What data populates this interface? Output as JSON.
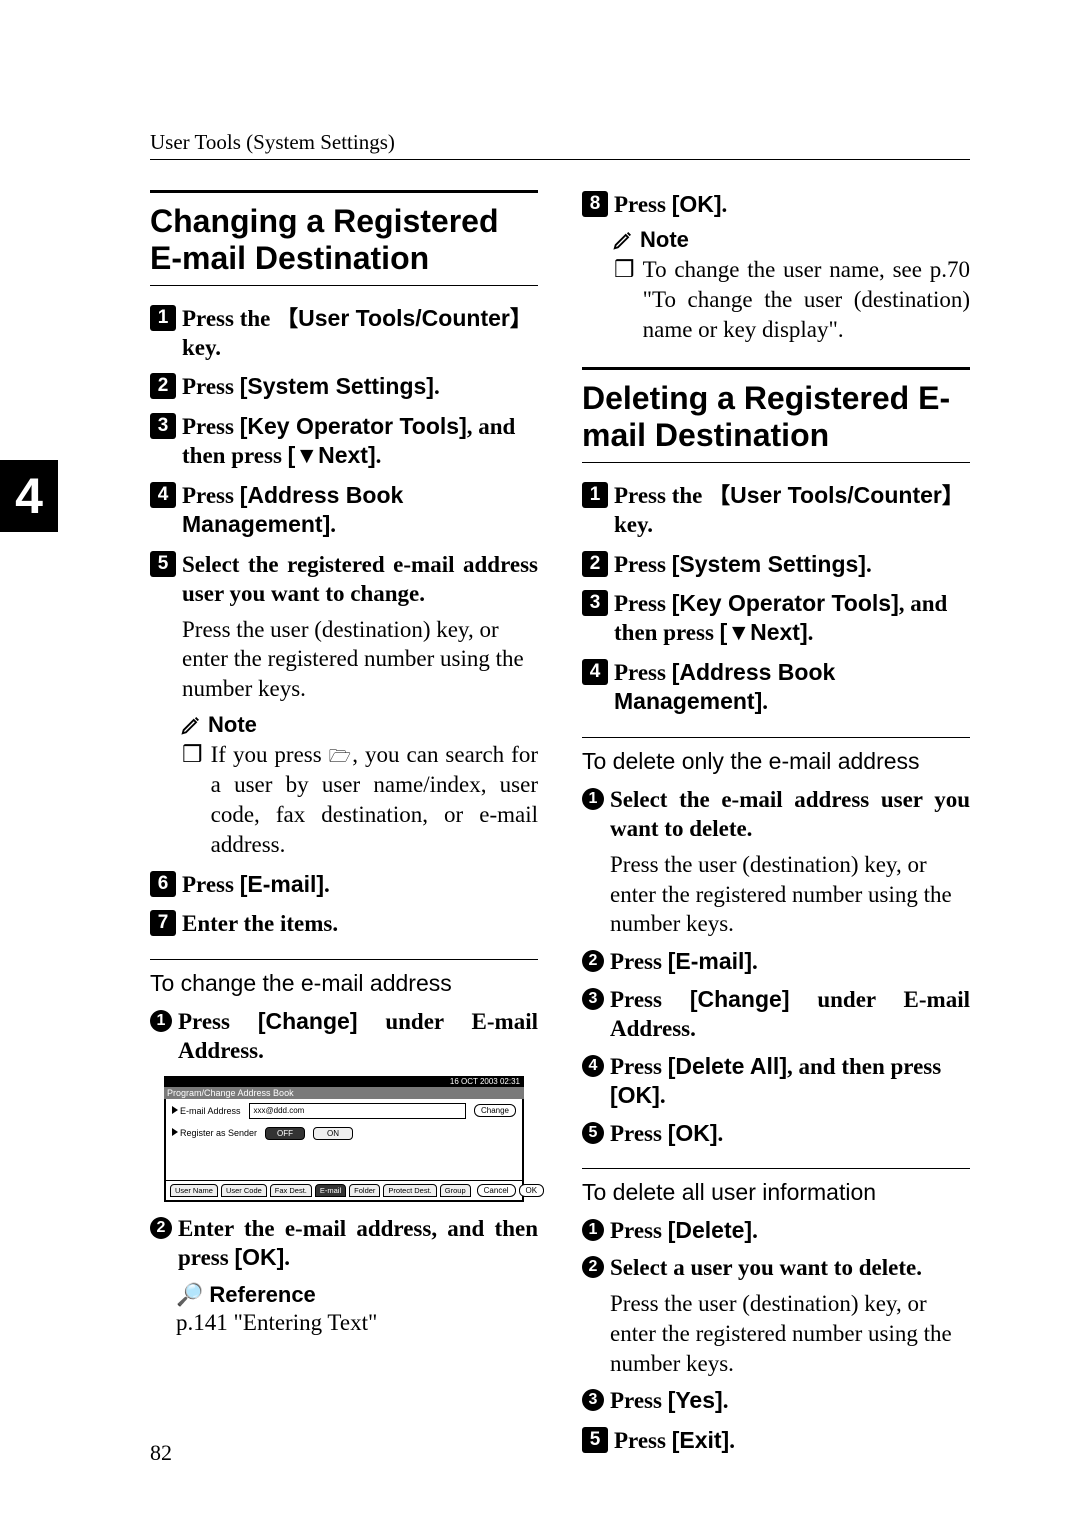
{
  "running_head": "User Tools (System Settings)",
  "chapter_tab": "4",
  "page_number": "82",
  "left": {
    "section_title": "Changing a Registered E-mail Destination",
    "s1_a": "Press the ",
    "s1_b": "User Tools/Counter",
    "s1_c": " key.",
    "s2_a": "Press ",
    "s2_b": "[System Settings]",
    "s2_c": ".",
    "s3_a": "Press ",
    "s3_b": "[Key Operator Tools]",
    "s3_c": ", and then press ",
    "s3_d": "[",
    "s3_e": "Next]",
    "s3_f": ".",
    "s4_a": "Press ",
    "s4_b": "[Address Book Management]",
    "s4_c": ".",
    "s5": "Select the registered e-mail address user you want to change.",
    "s5_cont": "Press the user (destination) key, or enter the registered number using the number keys.",
    "note_label": "Note",
    "note_item_a": "If you press ",
    "note_item_b": ", you can search for a user by user name/index, user code, fax destination, or e-mail address.",
    "s6_a": "Press ",
    "s6_b": "[E-mail]",
    "s6_c": ".",
    "s7": "Enter the items.",
    "subproc_title": "To change the e-mail address",
    "sub1_a": "Press ",
    "sub1_b": "[Change]",
    "sub1_c": " under E-mail Address.",
    "sub2_a": "Enter the e-mail address, and then press ",
    "sub2_b": "[OK]",
    "sub2_c": ".",
    "ref_label": "Reference",
    "ref_text": "p.141 \"Entering Text\"",
    "figure": {
      "clock": "16  OCT    2003 02:31",
      "titlebar": "Program/Change Address Book",
      "row1_label": "E-mail Address",
      "row1_value": "xxx@ddd.com",
      "row1_btn": "Change",
      "row2_label": "Register as Sender",
      "row2_off": "OFF",
      "row2_on": "ON",
      "tabs": [
        "User Name",
        "User Code",
        "Fax Dest.",
        "E-mail",
        "Folder",
        "Protect Dest.",
        "Group"
      ],
      "cancel": "Cancel",
      "ok": "OK"
    }
  },
  "right": {
    "s8_a": "Press ",
    "s8_b": "[OK]",
    "s8_c": ".",
    "note_label": "Note",
    "note_item": "To change the user name, see p.70 \"To change the user (destination) name or key display\".",
    "section_title": "Deleting a Registered E-mail Destination",
    "s1_a": "Press the ",
    "s1_b": "User Tools/Counter",
    "s1_c": " key.",
    "s2_a": "Press ",
    "s2_b": "[System Settings]",
    "s2_c": ".",
    "s3_a": "Press ",
    "s3_b": "[Key Operator Tools]",
    "s3_c": ", and then press ",
    "s3_d": "[",
    "s3_e": "Next]",
    "s3_f": ".",
    "s4_a": "Press ",
    "s4_b": "[Address Book Management]",
    "s4_c": ".",
    "subA_title": "To delete only the e-mail address",
    "a1": "Select the e-mail address user you want to delete.",
    "a1_cont": "Press the user (destination) key, or enter the registered number using the number keys.",
    "a2_a": "Press ",
    "a2_b": "[E-mail]",
    "a2_c": ".",
    "a3_a": "Press ",
    "a3_b": "[Change]",
    "a3_c": " under E-mail Address.",
    "a4_a": "Press ",
    "a4_b": "[Delete All]",
    "a4_c": ", and then press ",
    "a4_d": "[OK]",
    "a4_e": ".",
    "a5_a": "Press ",
    "a5_b": "[OK]",
    "a5_c": ".",
    "subB_title": "To delete all user information",
    "b1_a": "Press ",
    "b1_b": "[Delete]",
    "b1_c": ".",
    "b2": "Select a user you want to delete.",
    "b2_cont": "Press the user (destination) key, or enter the registered number using the number keys.",
    "b3_a": "Press ",
    "b3_b": "[Yes]",
    "b3_c": ".",
    "s5_a": "Press ",
    "s5_b": "[Exit]",
    "s5_c": "."
  }
}
